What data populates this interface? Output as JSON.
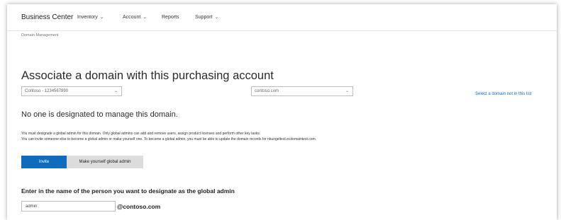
{
  "nav": {
    "brand": "Business Center",
    "items": [
      {
        "label": "Inventory",
        "has_dropdown": true
      },
      {
        "label": "Account",
        "has_dropdown": true
      },
      {
        "label": "Reports",
        "has_dropdown": false
      },
      {
        "label": "Support",
        "has_dropdown": true
      }
    ]
  },
  "breadcrumb": "Domain Management",
  "page": {
    "title": "Associate a domain with this purchasing account",
    "account_select": "Contoso - 1234567890",
    "domain_select": "contoso.com",
    "select_other_link": "Select a domain not in this list",
    "status": "No one is designated to manage this domain.",
    "description_line1": "You must designate a global admin for this domain. Only global admins can add and remove users, assign product licenses and perform other key tasks.",
    "description_line2": "You can invite someone else to become a global admin or make yourself one. To become a global admin, you must be able to update the domain records for nkungeltest.ecdomaintest.com.",
    "invite_button": "Invite",
    "make_admin_button": "Make yourself global admin",
    "enter_name_label": "Enter in the name of the person you want to designate as the global admin",
    "name_input_value": "admin",
    "domain_suffix": "@contoso.com"
  },
  "colors": {
    "accent": "#0f6cbd",
    "secondary_button": "#dcdcdc"
  },
  "icons": {
    "dropdown": "chevron-down-icon"
  }
}
